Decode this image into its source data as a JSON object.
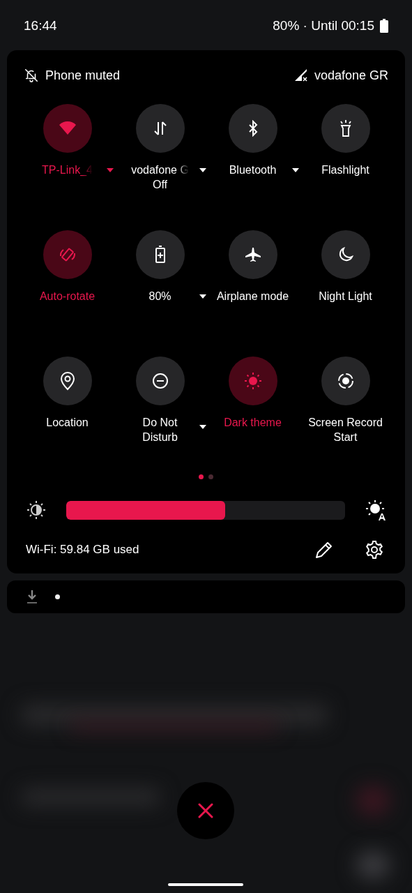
{
  "status_bar": {
    "time": "16:44",
    "battery_text": "80% · Until 00:15"
  },
  "header": {
    "ringer": "Phone muted",
    "carrier": "vodafone GR"
  },
  "tiles": [
    {
      "label": "TP-Link_4",
      "on": true,
      "dropdown": true,
      "faded": true
    },
    {
      "label": "vodafone G",
      "sublabel": "Off",
      "on": false,
      "dropdown": true,
      "faded": true
    },
    {
      "label": "Bluetooth",
      "on": false,
      "dropdown": true
    },
    {
      "label": "Flashlight",
      "on": false,
      "dropdown": false
    },
    {
      "label": "Auto-rotate",
      "on": true,
      "dropdown": false
    },
    {
      "label": "80%",
      "on": false,
      "dropdown": true
    },
    {
      "label": "Airplane mode",
      "on": false,
      "dropdown": false
    },
    {
      "label": "Night Light",
      "on": false,
      "dropdown": false
    },
    {
      "label": "Location",
      "on": false,
      "dropdown": false
    },
    {
      "label": "Do Not Disturb",
      "on": false,
      "dropdown": true
    },
    {
      "label": "Dark theme",
      "on": true,
      "dropdown": false
    },
    {
      "label": "Screen Record Start",
      "on": false,
      "dropdown": false
    }
  ],
  "pages": [
    {
      "selected": true
    },
    {
      "selected": false
    }
  ],
  "brightness": {
    "level": 0.57
  },
  "footer": {
    "data_usage": "Wi-Fi: 59.84 GB used"
  }
}
